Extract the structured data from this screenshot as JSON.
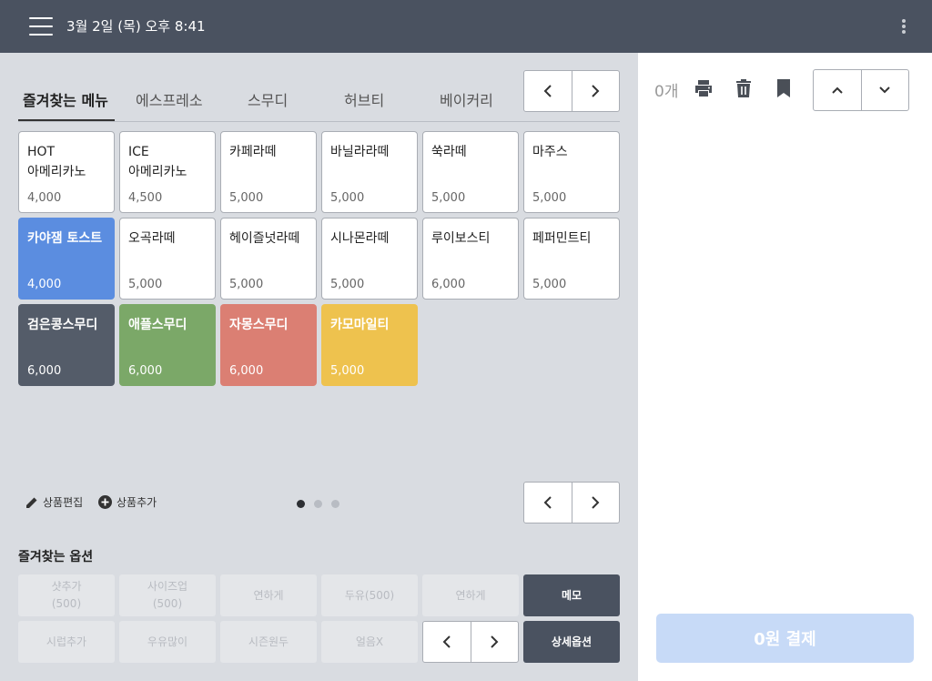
{
  "topbar": {
    "datetime": "3월 2일 (목) 오후 8:41"
  },
  "tabs": [
    {
      "label": "즐겨찾는 메뉴"
    },
    {
      "label": "에스프레소"
    },
    {
      "label": "스무디"
    },
    {
      "label": "허브티"
    },
    {
      "label": "베이커리"
    }
  ],
  "products": [
    {
      "name": "HOT\n아메리카노",
      "price": "4,000"
    },
    {
      "name": "ICE\n아메리카노",
      "price": "4,500"
    },
    {
      "name": "카페라떼",
      "price": "5,000"
    },
    {
      "name": "바닐라라떼",
      "price": "5,000"
    },
    {
      "name": "쑥라떼",
      "price": "5,000"
    },
    {
      "name": "마주스",
      "price": "5,000"
    },
    {
      "name": "카야잼 토스트",
      "price": "4,000",
      "color": "#5b8de0"
    },
    {
      "name": "오곡라떼",
      "price": "5,000"
    },
    {
      "name": "헤이즐넛라떼",
      "price": "5,000"
    },
    {
      "name": "시나몬라떼",
      "price": "5,000"
    },
    {
      "name": "루이보스티",
      "price": "6,000"
    },
    {
      "name": "페퍼민트티",
      "price": "5,000"
    },
    {
      "name": "검은콩스무디",
      "price": "6,000",
      "color": "#545c69"
    },
    {
      "name": "애플스무디",
      "price": "6,000",
      "color": "#7ba868"
    },
    {
      "name": "자몽스무디",
      "price": "6,000",
      "color": "#db7f73"
    },
    {
      "name": "카모마일티",
      "price": "5,000",
      "color": "#eec24e"
    }
  ],
  "actions": {
    "edit_label": "상품편집",
    "add_label": "상품추가"
  },
  "pagination": {
    "total": 3,
    "current": 1
  },
  "options": {
    "title": "즐겨찾는 옵션",
    "items": [
      {
        "line1": "샷추가",
        "line2": "(500)"
      },
      {
        "line1": "사이즈업",
        "line2": "(500)"
      },
      {
        "line1": "연하게"
      },
      {
        "line1": "두유(500)"
      },
      {
        "line1": "연하게"
      },
      {
        "line1": "메모",
        "dark": true
      },
      {
        "line1": "시럽추가"
      },
      {
        "line1": "우유많이"
      },
      {
        "line1": "시즌원두"
      },
      {
        "line1": "얼음X"
      },
      {
        "line1": "상세옵션",
        "dark": true
      }
    ]
  },
  "cart": {
    "count": "0개",
    "pay_label": "0원 결제"
  },
  "colors": {
    "topbar": "#4a5260",
    "pay_disabled": "#c7daf7"
  },
  "icons": [
    "menu-icon",
    "more-vert-icon",
    "print-icon",
    "trash-icon",
    "bookmark-icon",
    "chevron-left-icon",
    "chevron-right-icon",
    "chevron-up-icon",
    "chevron-down-icon",
    "pencil-icon",
    "plus-circle-icon"
  ]
}
